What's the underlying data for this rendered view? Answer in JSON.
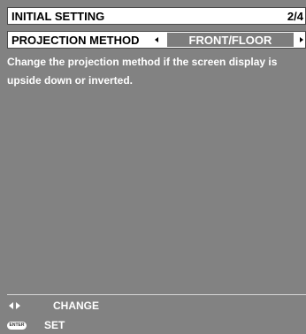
{
  "title": "INITIAL SETTING",
  "page_indicator": "2/4",
  "setting": {
    "label": "PROJECTION METHOD",
    "value": "FRONT/FLOOR"
  },
  "description": "Change the projection method if the screen display is upside down or inverted.",
  "help": {
    "change_label": "CHANGE",
    "enter_icon_text": "ENTER",
    "set_label": "SET"
  },
  "colors": {
    "panel_bg": "#828282",
    "value_bg": "#7d7d7d",
    "text_on_dark": "#ffffff"
  }
}
